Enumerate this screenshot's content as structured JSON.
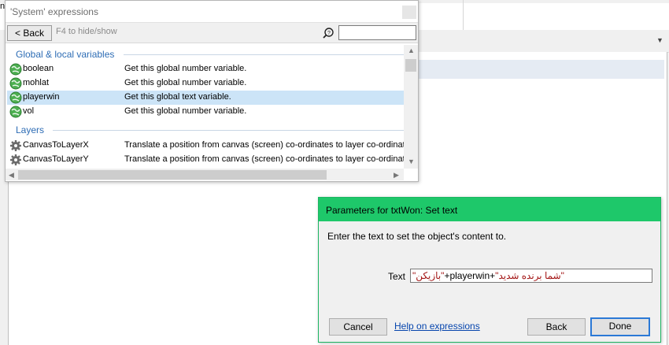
{
  "background": {
    "top_left_text": "n"
  },
  "expressions_panel": {
    "title": "'System' expressions",
    "back_label": "< Back",
    "hint": "F4 to hide/show",
    "search_value": "",
    "sections": [
      {
        "label": "Global & local variables",
        "items": [
          {
            "name": "boolean",
            "description": "Get this global number variable.",
            "icon": "globe-icon",
            "selected": false
          },
          {
            "name": "mohlat",
            "description": "Get this global number variable.",
            "icon": "globe-icon",
            "selected": false
          },
          {
            "name": "playerwin",
            "description": "Get this global text variable.",
            "icon": "globe-icon",
            "selected": true
          },
          {
            "name": "vol",
            "description": "Get this global number variable.",
            "icon": "globe-icon",
            "selected": false
          }
        ]
      },
      {
        "label": "Layers",
        "items": [
          {
            "name": "CanvasToLayerX",
            "description": "Translate a position from canvas (screen) co-ordinates to layer co-ordinat",
            "icon": "gear-icon",
            "selected": false
          },
          {
            "name": "CanvasToLayerY",
            "description": "Translate a position from canvas (screen) co-ordinates to layer co-ordinat",
            "icon": "gear-icon",
            "selected": false
          }
        ]
      }
    ]
  },
  "parameters_dialog": {
    "title": "Parameters for txtWon: Set text",
    "message": "Enter the text to set the object's content to.",
    "text_label": "Text",
    "text_value": {
      "part1": "\"شما برنده شدید\"",
      "op1": "+",
      "part2": "playerwin",
      "op2": "+",
      "part3": "\"بازیکن\""
    },
    "cancel_label": "Cancel",
    "help_label": "Help on expressions",
    "back_label": "Back",
    "done_label": "Done"
  },
  "colors": {
    "accent_green": "#1ec86a",
    "section_blue": "#2e6db5",
    "selection": "#cce4f7",
    "string_red": "#a31515"
  }
}
